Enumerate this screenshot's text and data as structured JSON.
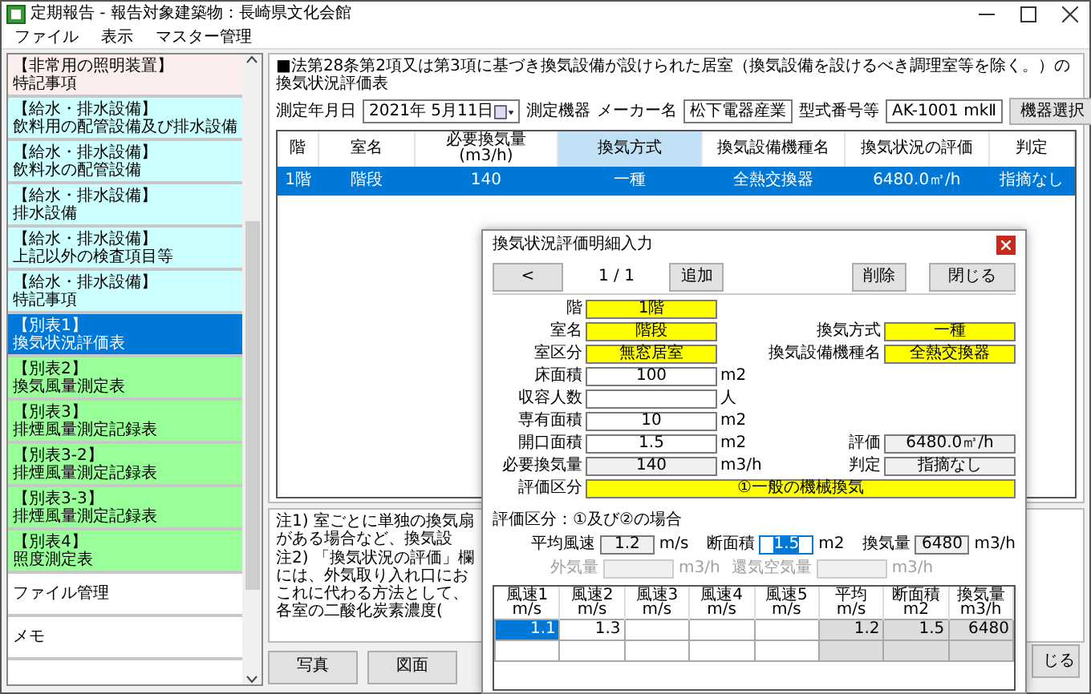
{
  "window": {
    "title": "定期報告 - 報告対象建築物：長崎県文化会館"
  },
  "menu": [
    "ファイル",
    "表示",
    "マスター管理"
  ],
  "sidebar": {
    "items": [
      {
        "lines": [
          "【非常用の照明装置】",
          "特記事項"
        ],
        "color": "#fdeeee",
        "selected": false
      },
      {
        "lines": [
          "【給水・排水設備】",
          "飲料用の配管設備及び排水設備"
        ],
        "color": "#ccffff",
        "selected": false
      },
      {
        "lines": [
          "【給水・排水設備】",
          "飲料水の配管設備"
        ],
        "color": "#ccffff",
        "selected": false
      },
      {
        "lines": [
          "【給水・排水設備】",
          "排水設備"
        ],
        "color": "#ccffff",
        "selected": false
      },
      {
        "lines": [
          "【給水・排水設備】",
          "上記以外の検査項目等"
        ],
        "color": "#ccffff",
        "selected": false
      },
      {
        "lines": [
          "【給水・排水設備】",
          "特記事項"
        ],
        "color": "#ccffff",
        "selected": false
      },
      {
        "lines": [
          "【別表1】",
          "換気状況評価表"
        ],
        "color": "#0078d7",
        "selected": true
      },
      {
        "lines": [
          "【別表2】",
          "換気風量測定表"
        ],
        "color": "#99ff99",
        "selected": false
      },
      {
        "lines": [
          "【別表3】",
          "排煙風量測定記録表"
        ],
        "color": "#99ff99",
        "selected": false
      },
      {
        "lines": [
          "【別表3-2】",
          "排煙風量測定記録表"
        ],
        "color": "#99ff99",
        "selected": false
      },
      {
        "lines": [
          "【別表3-3】",
          "排煙風量測定記録表"
        ],
        "color": "#99ff99",
        "selected": false
      },
      {
        "lines": [
          "【別表4】",
          "照度測定表"
        ],
        "color": "#99ff99",
        "selected": false
      },
      {
        "lines": [
          "ファイル管理"
        ],
        "color": "#ffffff",
        "selected": false
      },
      {
        "lines": [
          "メモ"
        ],
        "color": "#ffffff",
        "selected": false
      }
    ]
  },
  "section": {
    "title": "■法第28条第2項又は第3項に基づき換気設備が設けられた居室（換気設備を設けるべき調理室等を除く。）の換気状況評価表",
    "date_label": "測定年月日",
    "date": "2021年 5月11日",
    "device_label": "測定機器",
    "maker_label": "メーカー名",
    "maker": "松下電器産業",
    "model_label": "型式番号等",
    "model": "AK-1001 mkⅡ",
    "select_button": "機器選択"
  },
  "table": {
    "columns": [
      {
        "label": "階",
        "selected": false
      },
      {
        "label": "室名",
        "selected": false
      },
      {
        "label": "必要換気量",
        "unit": "(m3/h)",
        "selected": false
      },
      {
        "label": "換気方式",
        "selected": true
      },
      {
        "label": "換気設備機種名",
        "selected": false
      },
      {
        "label": "換気状況の評価",
        "selected": false
      },
      {
        "label": "判定",
        "selected": false
      }
    ],
    "rows": [
      {
        "cells": [
          "1階",
          "階段",
          "140",
          "一種",
          "全熱交換器",
          "6480.0㎥/h",
          "指摘なし"
        ],
        "selected": true
      }
    ]
  },
  "notes": [
    [
      "注1) 室ごとに単独の換気扇がある場合など、換気設"
    ],
    [
      "注2) 「換気状況の評価」欄には、外気取り入れ口にお",
      "これに代わる方法として、各室の二酸化炭素濃度("
    ]
  ],
  "buttons": [
    "写真",
    "図面"
  ],
  "hidden_button": "じる",
  "dialog": {
    "title": "換気状況評価明細入力",
    "prev": "<",
    "page": "1 / 1",
    "add": "追加",
    "delete": "削除",
    "close": "閉じる",
    "rows": [
      {
        "left": {
          "label": "階",
          "value": "1階",
          "kind": "highlight"
        }
      },
      {
        "left": {
          "label": "室名",
          "value": "階段",
          "kind": "highlight"
        },
        "right": {
          "label": "換気方式",
          "value": "一種",
          "kind": "highlight"
        }
      },
      {
        "left": {
          "label": "室区分",
          "value": "無窓居室",
          "kind": "highlight"
        },
        "right": {
          "label": "換気設備機種名",
          "value": "全熱交換器",
          "kind": "highlight"
        }
      },
      {
        "left": {
          "label": "床面積",
          "value": "100",
          "kind": "input",
          "unit": "m2"
        }
      },
      {
        "left": {
          "label": "収容人数",
          "kind": "input",
          "unit": "人"
        }
      },
      {
        "left": {
          "label": "専有面積",
          "value": "10",
          "kind": "input",
          "unit": "m2"
        }
      },
      {
        "left": {
          "label": "開口面積",
          "value": "1.5",
          "kind": "input",
          "unit": "m2"
        },
        "right": {
          "label": "評価",
          "value": "6480.0㎥/h",
          "kind": "readonly"
        }
      },
      {
        "left": {
          "label": "必要換気量",
          "value": "140",
          "kind": "readonly",
          "unit": "m3/h"
        },
        "right": {
          "label": "判定",
          "value": "指摘なし",
          "kind": "readonly"
        }
      },
      {
        "wide": {
          "label": "評価区分",
          "value": "①一般の機械換気",
          "kind": "highlight"
        }
      }
    ],
    "case_title": "評価区分：①及び②の場合",
    "measure": [
      {
        "label": "平均風速",
        "value": "1.2",
        "unit": "m/s",
        "focused": false
      },
      {
        "label": "断面積",
        "value": "1.5",
        "unit": "m2",
        "focused": true
      },
      {
        "label": "換気量",
        "value": "6480",
        "unit": "m3/h",
        "focused": false
      }
    ],
    "measure2": [
      {
        "label": "外気量",
        "unit": "m3/h",
        "disabled": true
      },
      {
        "label": "還気空気量",
        "unit": "m3/h",
        "disabled": true
      }
    ],
    "grid": {
      "columns": [
        {
          "name": "風速1",
          "unit": "m/s",
          "readonly": false
        },
        {
          "name": "風速2",
          "unit": "m/s",
          "readonly": false
        },
        {
          "name": "風速3",
          "unit": "m/s",
          "readonly": false
        },
        {
          "name": "風速4",
          "unit": "m/s",
          "readonly": false
        },
        {
          "name": "風速5",
          "unit": "m/s",
          "readonly": false
        },
        {
          "name": "平均",
          "unit": "m/s",
          "readonly": true
        },
        {
          "name": "断面積",
          "unit": "m2",
          "readonly": true
        },
        {
          "name": "換気量",
          "unit": "m3/h",
          "readonly": true
        }
      ],
      "rows": [
        {
          "cells": [
            {
              "value": "1.1",
              "selected": true
            },
            {
              "value": "1.3",
              "selected": false
            },
            {
              "selected": false
            },
            {
              "selected": false
            },
            {
              "selected": false
            },
            {
              "value": "1.2",
              "selected": false
            },
            {
              "value": "1.5",
              "selected": false
            },
            {
              "value": "6480",
              "selected": false
            }
          ]
        },
        {
          "cells": [
            {
              "selected": false
            },
            {
              "selected": false
            },
            {
              "selected": false
            },
            {
              "selected": false
            },
            {
              "selected": false
            },
            {
              "selected": false
            },
            {
              "selected": false
            },
            {
              "selected": false
            }
          ]
        }
      ]
    }
  }
}
